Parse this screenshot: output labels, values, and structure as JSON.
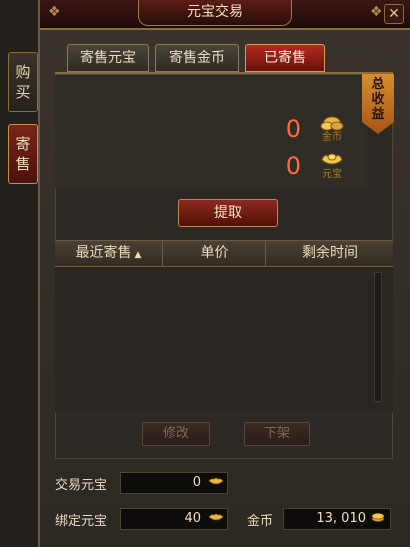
{
  "window": {
    "title": "元宝交易",
    "close_symbol": "✕"
  },
  "side_tabs": {
    "buy": [
      "购",
      "买"
    ],
    "sell": [
      "寄",
      "售"
    ]
  },
  "tabs": [
    {
      "label": "寄售元宝"
    },
    {
      "label": "寄售金币"
    },
    {
      "label": "已寄售",
      "selected": true
    }
  ],
  "earnings": {
    "banner": [
      "总",
      "收",
      "益"
    ],
    "gold_amount": "0",
    "gold_icon_text": "金币",
    "yuanbao_amount": "0",
    "yuanbao_icon_text": "元宝"
  },
  "withdraw_label": "提取",
  "list": {
    "columns": [
      "最近寄售",
      "单价",
      "剩余时间"
    ],
    "sort_indicator": "▲",
    "rows": []
  },
  "actions": {
    "modify_label": "修改",
    "remove_label": "下架"
  },
  "balances": {
    "trade_yuanbao_label": "交易元宝",
    "trade_yuanbao_value": "0",
    "bind_yuanbao_label": "绑定元宝",
    "bind_yuanbao_value": "40",
    "gold_label": "金币",
    "gold_value": "13, 010"
  },
  "colors": {
    "accent_red": "#b02a20",
    "amount_orange": "#ff6a3a",
    "gold": "#d9a53a"
  }
}
